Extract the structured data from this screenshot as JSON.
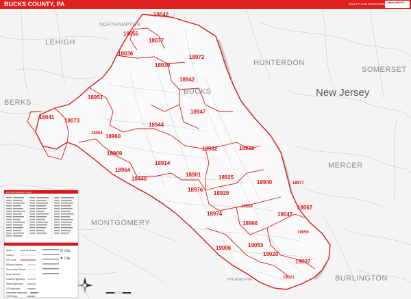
{
  "header": {
    "title": "BUCKS COUNTY, PA",
    "edition": "2023 ZIP Code Redline Edition",
    "brand": "MarketMAPS"
  },
  "map": {
    "state_labels": [
      "New Jersey"
    ],
    "county_labels": [
      "LEHIGH",
      "NORTHAMPTON",
      "HUNTERDON",
      "SOMERSET",
      "BERKS",
      "BUCKS",
      "MERCER",
      "MONTGOMERY",
      "BURLINGTON"
    ],
    "place_labels": [
      "PHILADELPHIA"
    ],
    "zip_labels": [
      "18042",
      "18055",
      "18077",
      "18036",
      "18972",
      "18930",
      "18942",
      "18951",
      "18947",
      "18041",
      "18073",
      "18944",
      "18054",
      "18960",
      "18902",
      "18938",
      "18969",
      "18914",
      "18964",
      "18440",
      "18901",
      "18925",
      "18940",
      "18976",
      "18929",
      "18977",
      "18954",
      "18067",
      "18974",
      "18966",
      "19047",
      "19006",
      "19053",
      "19056",
      "19020",
      "19007",
      "19021"
    ],
    "colors": {
      "zip_boundary": "#d81818",
      "zip_label": "#d81818",
      "road": "#9a9a9a",
      "background": "#f4f4f4",
      "water": "#cfcfcf"
    }
  },
  "zip_index": {
    "title": "ZIP Code Index/City Locator"
  },
  "legend": {
    "items": [
      {
        "label": "State"
      },
      {
        "label": "County"
      },
      {
        "label": "ZIP Code"
      },
      {
        "label": "Primary Streets"
      },
      {
        "label": "Secondary Streets"
      },
      {
        "label": "Minor Streets"
      },
      {
        "label": "County Highways"
      },
      {
        "label": "State Highways"
      },
      {
        "label": "US Highways"
      },
      {
        "label": "Interstate Highways"
      },
      {
        "label": "Toll Roads"
      }
    ],
    "city_label": "City"
  }
}
